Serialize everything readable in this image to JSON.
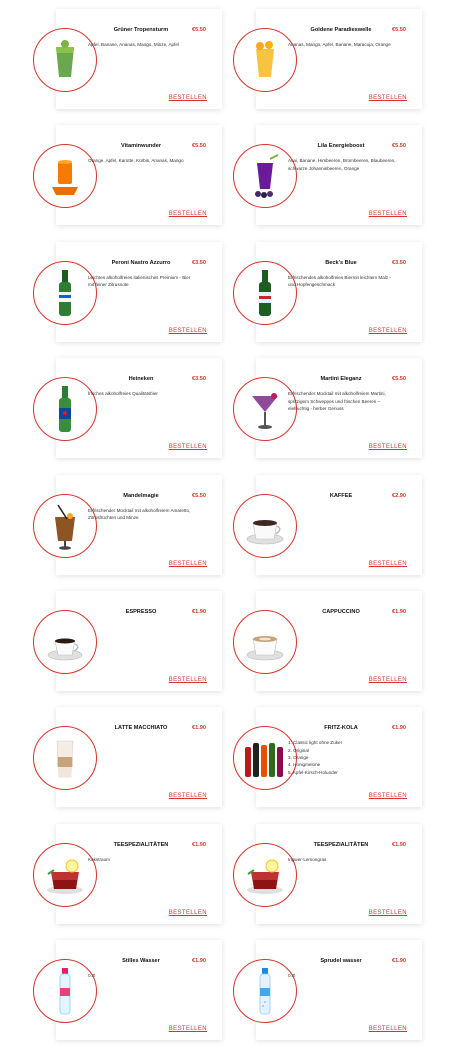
{
  "colors": {
    "accent": "#d9342b"
  },
  "order_label": "BESTELLEN",
  "products": [
    {
      "name": "Grüner Tropensturm",
      "price": "€5.50",
      "desc": [
        "Apfel, Banane, Ananas, Mango, Minze, Apfel"
      ],
      "icon": "green-smoothie-icon"
    },
    {
      "name": "Goldene Paradieswelle",
      "price": "€5.50",
      "desc": [
        "Ananas, Mango, Apfel, Banane, Maracuja, Orange"
      ],
      "icon": "yellow-smoothie-icon"
    },
    {
      "name": "Vitaminwunder",
      "price": "€5.50",
      "desc": [
        "Orange, Apfel, Karotte, Kürbis, Ananas, Mango"
      ],
      "icon": "orange-juice-icon"
    },
    {
      "name": "Lila Energieboost",
      "price": "€5.50",
      "desc": [
        "Acai, Banane, Himbeeren, Brombeeren, Blaubeeren,",
        "schwarze Johannisbeeren, Orange"
      ],
      "icon": "purple-smoothie-icon"
    },
    {
      "name": "Peroni Nastro Azzurro",
      "price": "€3.50",
      "desc": [
        "Leichtes alkoholfreies italienisches Premium - Bier",
        "mit feiner Zitrusnote"
      ],
      "icon": "peroni-bottle-icon"
    },
    {
      "name": "Beck's Blue",
      "price": "€3.50",
      "desc": [
        "Erfrischendes alkoholfreies Biermit leichtem Malz -",
        "und Hopfengeschmack"
      ],
      "icon": "becks-bottle-icon"
    },
    {
      "name": "Heineken",
      "price": "€3.50",
      "desc": [
        "frisches alkoholfreies Qualitätsbier"
      ],
      "icon": "heineken-bottle-icon"
    },
    {
      "name": "Martini Eleganz",
      "price": "€5.50",
      "desc": [
        "Erfrischender Mocktail mit alkoholfreiem Martini,",
        "spritzigem Schweppes und frischen Beeren –",
        "elefruchtig - herber Genuss"
      ],
      "icon": "martini-glass-icon"
    },
    {
      "name": "Mandelmagie",
      "price": "€5.50",
      "desc": [
        "Erfrischender Mocktail mit alkoholfreiem Amaretto,",
        "Zitrusfrüchten und Minze"
      ],
      "icon": "amaretto-glass-icon"
    },
    {
      "name": "KAFFEE",
      "price": "€2.90",
      "desc": [],
      "icon": "coffee-cup-icon"
    },
    {
      "name": "ESPRESSO",
      "price": "€1.90",
      "desc": [],
      "icon": "espresso-cup-icon"
    },
    {
      "name": "CAPPUCCINO",
      "price": "€1.90",
      "desc": [],
      "icon": "cappuccino-cup-icon"
    },
    {
      "name": "LATTE MACCHIATO",
      "price": "€1.90",
      "desc": [],
      "icon": "latte-glass-icon"
    },
    {
      "name": "FRITZ-KOLA",
      "price": "€1.90",
      "desc": [
        "1. Classic light ohne Zuker",
        "2. Original",
        "3. Orange",
        "4. Honigmelone",
        "5. Apfel-Kirsch-Holunder"
      ],
      "icon": "fritz-kola-bottles-icon"
    },
    {
      "name": "TEESPEZIALITÄTEN",
      "price": "€1.90",
      "desc": [
        "Kekstraum"
      ],
      "icon": "tea-glass-icon"
    },
    {
      "name": "TEESPEZIALITÄTEN",
      "price": "€1.90",
      "desc": [
        "Ingwer-Lemongras"
      ],
      "icon": "tea-glass-icon"
    },
    {
      "name": "Stilles Wasser",
      "price": "€1.90",
      "desc": [
        "0.2l"
      ],
      "icon": "still-water-bottle-icon"
    },
    {
      "name": "Sprudel wasser",
      "price": "€1.90",
      "desc": [
        "0.2l"
      ],
      "icon": "sparkling-water-bottle-icon"
    }
  ]
}
